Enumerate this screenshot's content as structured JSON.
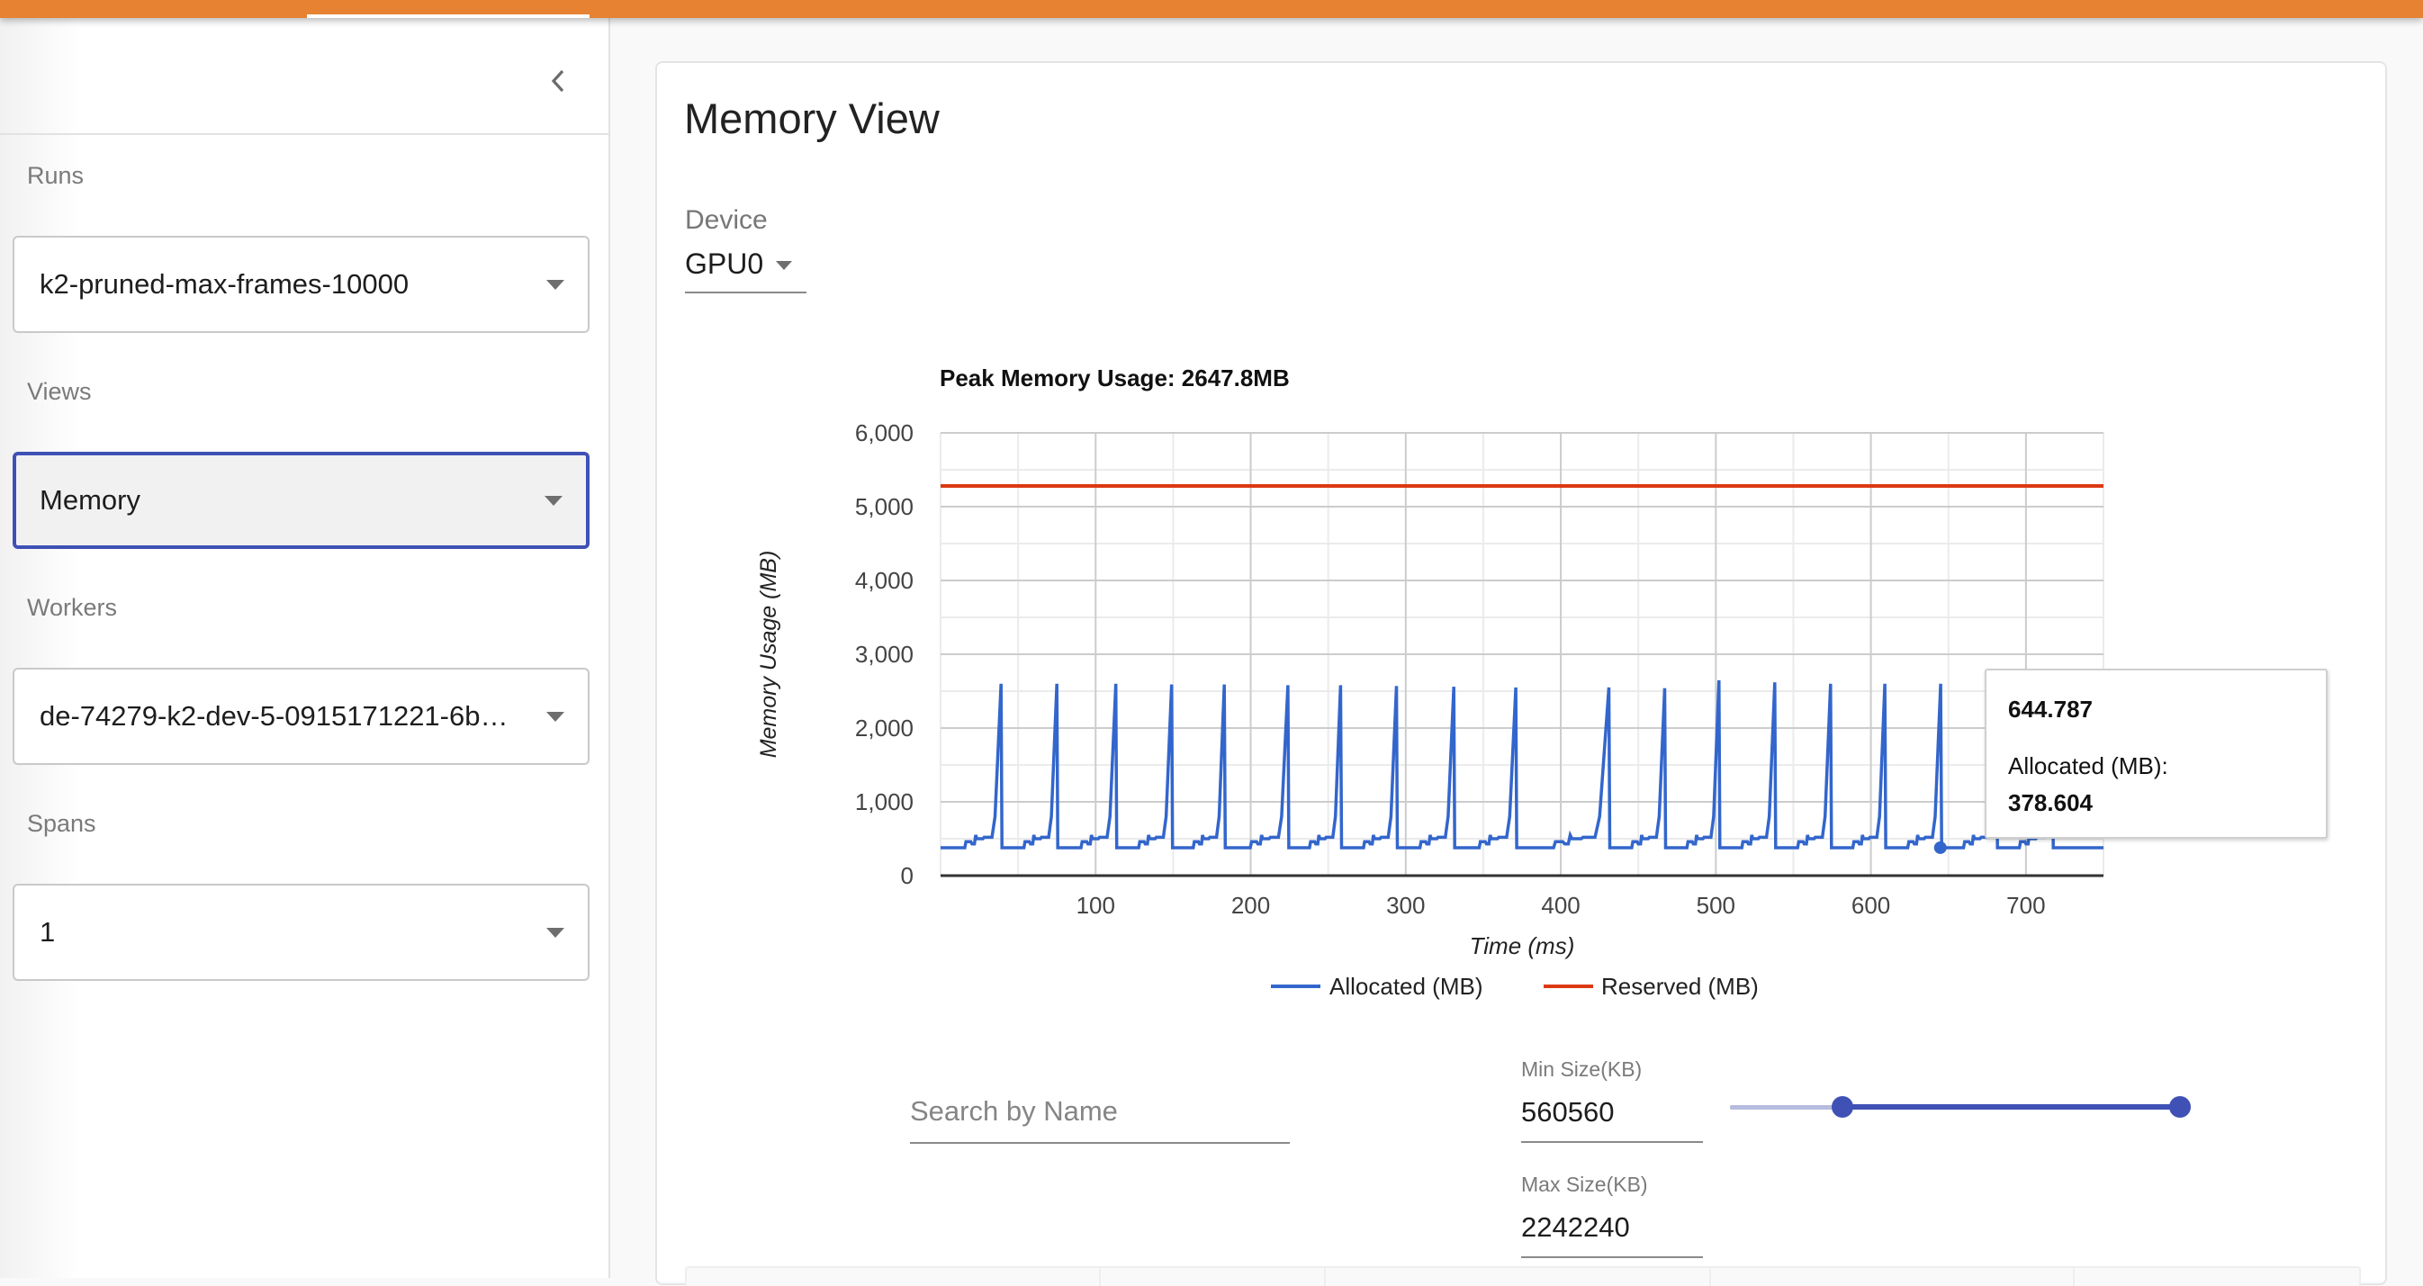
{
  "header": {
    "accent_color": "#e68232",
    "active_tab_indicator": "white-underline"
  },
  "sidebar": {
    "collapse_icon": "chevron-left-icon",
    "sections": [
      {
        "label": "Runs",
        "value": "k2-pruned-max-frames-10000",
        "focused": false
      },
      {
        "label": "Views",
        "value": "Memory",
        "focused": true
      },
      {
        "label": "Workers",
        "value": "de-74279-k2-dev-5-0915171221-6b…",
        "focused": false
      },
      {
        "label": "Spans",
        "value": "1",
        "focused": false
      }
    ]
  },
  "main": {
    "title": "Memory View",
    "device": {
      "label": "Device",
      "value": "GPU0"
    },
    "tooltip": {
      "x_value": "644.787",
      "series_label": "Allocated (MB):",
      "series_value": "378.604"
    },
    "filters": {
      "search_placeholder": "Search by Name",
      "search_value": "",
      "min_size_label": "Min Size(KB)",
      "min_size_value": "560560",
      "max_size_label": "Max Size(KB)",
      "max_size_value": "2242240",
      "slider_range": {
        "min_fraction": 0.25,
        "max_fraction": 1.0
      }
    },
    "table": {
      "column_count": 5
    }
  },
  "chart_data": {
    "type": "line",
    "title": "Peak Memory Usage: 2647.8MB",
    "xlabel": "Time (ms)",
    "ylabel": "Memory Usage (MB)",
    "xlim": [
      0,
      750
    ],
    "ylim": [
      0,
      6000
    ],
    "x_ticks": [
      100,
      200,
      300,
      400,
      500,
      600,
      700
    ],
    "x_tick_labels": [
      "100",
      "200",
      "300",
      "400",
      "500",
      "600",
      "700"
    ],
    "x_minor_gridlines": [
      50,
      150,
      250,
      350,
      450,
      550,
      650
    ],
    "y_ticks": [
      0,
      1000,
      2000,
      3000,
      4000,
      5000,
      6000
    ],
    "y_tick_labels": [
      "0",
      "1,000",
      "2,000",
      "3,000",
      "4,000",
      "5,000",
      "6,000"
    ],
    "y_minor_gridlines": [
      500,
      1500,
      2500,
      3500,
      4500,
      5500
    ],
    "grid": true,
    "legend": "bottom",
    "series": [
      {
        "name": "Allocated (MB)",
        "color": "#3366cc",
        "baseline_mb": 378.6,
        "spike_times_ms": [
          39,
          75,
          113,
          149,
          183,
          224,
          258,
          294,
          331,
          371,
          431,
          467,
          502,
          538,
          574,
          609,
          645,
          681,
          717
        ],
        "spike_peaks_mb": [
          2600,
          2600,
          2600,
          2590,
          2590,
          2580,
          2580,
          2570,
          2560,
          2550,
          2550,
          2540,
          2647.8,
          2620,
          2600,
          2600,
          2600,
          2600,
          2600
        ],
        "step_levels_mb": [
          460,
          430,
          550,
          500,
          520,
          800
        ]
      },
      {
        "name": "Reserved (MB)",
        "color": "#dc3912",
        "values": [
          [
            0,
            5280
          ],
          [
            750,
            5280
          ]
        ]
      }
    ],
    "hover_point": {
      "x": 644.787,
      "y": 378.604,
      "series": "Allocated (MB)"
    }
  }
}
